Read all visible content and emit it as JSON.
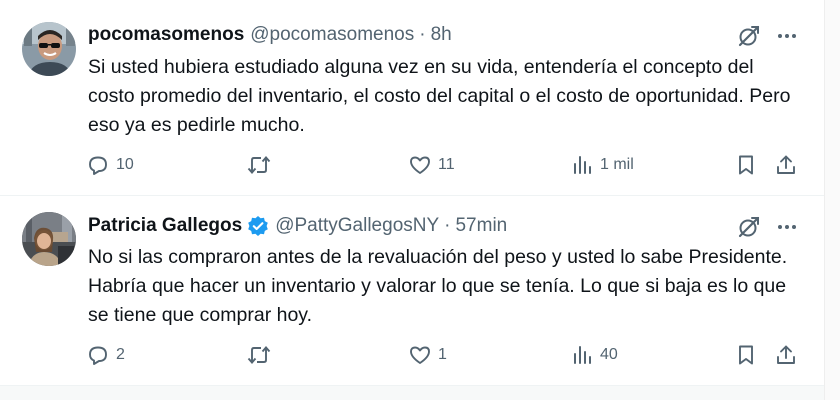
{
  "tweets": [
    {
      "display_name": "pocomasomenos",
      "handle": "@pocomasomenos",
      "separator": "·",
      "time": "8h",
      "verified": false,
      "text": "Si usted hubiera estudiado alguna vez en su vida, entendería el concepto del costo promedio del inventario, el costo del capital o el costo de oportunidad. Pero eso ya es pedirle mucho.",
      "replies": "10",
      "retweets": "",
      "likes": "11",
      "views": "1 mil",
      "icons": [
        "grok-icon",
        "more-icon",
        "reply-icon",
        "retweet-icon",
        "like-icon",
        "views-icon",
        "bookmark-icon",
        "share-icon"
      ]
    },
    {
      "display_name": "Patricia Gallegos",
      "handle": "@PattyGallegosNY",
      "separator": "·",
      "time": "57min",
      "verified": true,
      "text": "No si las compraron antes de la revaluación del peso y usted lo sabe Presidente. Habría que hacer un inventario y valorar lo que se tenía. Lo que si baja es lo que se tiene que comprar hoy.",
      "replies": "2",
      "retweets": "",
      "likes": "1",
      "views": "40",
      "icons": [
        "verified-badge-icon",
        "grok-icon",
        "more-icon",
        "reply-icon",
        "retweet-icon",
        "like-icon",
        "views-icon",
        "bookmark-icon",
        "share-icon"
      ]
    }
  ],
  "colors": {
    "text_primary": "#0f1419",
    "text_secondary": "#536471",
    "verified_blue": "#1d9bf0",
    "divider": "#eff3f4"
  }
}
